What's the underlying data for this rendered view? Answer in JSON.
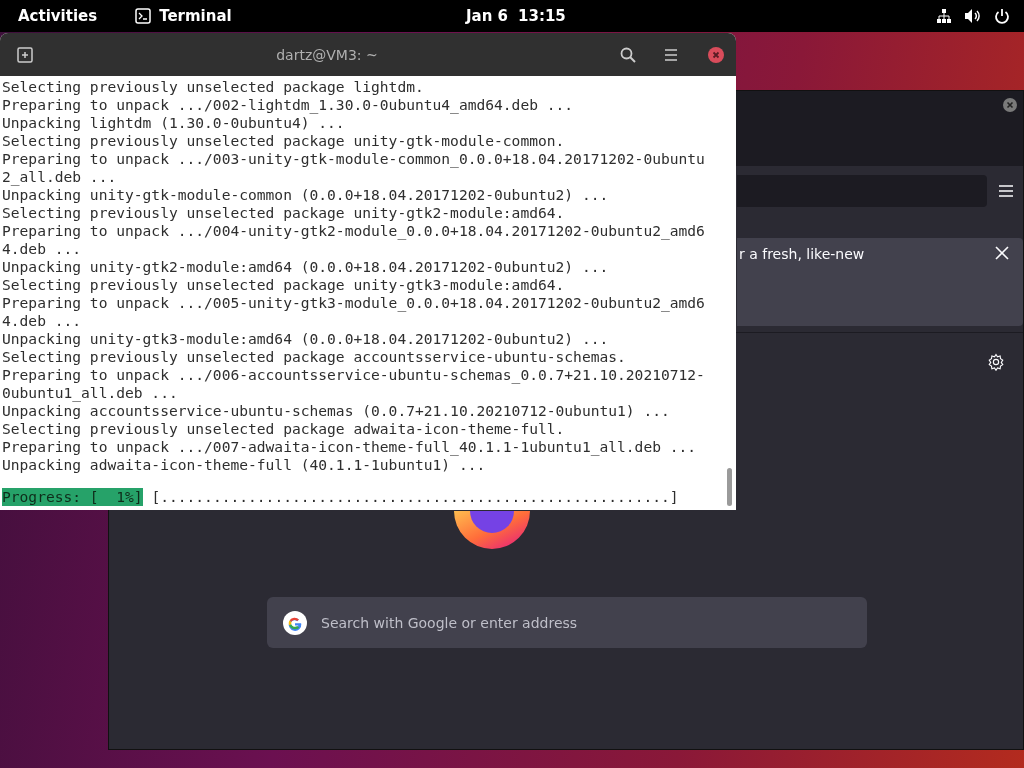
{
  "top_bar": {
    "activities": "Activities",
    "app": "Terminal",
    "date": "Jan 6",
    "time": "13:15"
  },
  "terminal": {
    "title": "dartz@VM3: ~",
    "lines": [
      "Selecting previously unselected package lightdm.",
      "Preparing to unpack .../002-lightdm_1.30.0-0ubuntu4_amd64.deb ...",
      "Unpacking lightdm (1.30.0-0ubuntu4) ...",
      "Selecting previously unselected package unity-gtk-module-common.",
      "Preparing to unpack .../003-unity-gtk-module-common_0.0.0+18.04.20171202-0ubuntu",
      "2_all.deb ...",
      "Unpacking unity-gtk-module-common (0.0.0+18.04.20171202-0ubuntu2) ...",
      "Selecting previously unselected package unity-gtk2-module:amd64.",
      "Preparing to unpack .../004-unity-gtk2-module_0.0.0+18.04.20171202-0ubuntu2_amd6",
      "4.deb ...",
      "Unpacking unity-gtk2-module:amd64 (0.0.0+18.04.20171202-0ubuntu2) ...",
      "Selecting previously unselected package unity-gtk3-module:amd64.",
      "Preparing to unpack .../005-unity-gtk3-module_0.0.0+18.04.20171202-0ubuntu2_amd6",
      "4.deb ...",
      "Unpacking unity-gtk3-module:amd64 (0.0.0+18.04.20171202-0ubuntu2) ...",
      "Selecting previously unselected package accountsservice-ubuntu-schemas.",
      "Preparing to unpack .../006-accountsservice-ubuntu-schemas_0.0.7+21.10.20210712-",
      "0ubuntu1_all.deb ...",
      "Unpacking accountsservice-ubuntu-schemas (0.0.7+21.10.20210712-0ubuntu1) ...",
      "Selecting previously unselected package adwaita-icon-theme-full.",
      "Preparing to unpack .../007-adwaita-icon-theme-full_40.1.1-1ubuntu1_all.deb ...",
      "Unpacking adwaita-icon-theme-full (40.1.1-1ubuntu1) ..."
    ],
    "progress_label": "Progress: [  1%]",
    "progress_bar": "[..........................................................]"
  },
  "browser": {
    "notice": "r a fresh, like-new",
    "search": {
      "placeholder": "Search with Google or enter address"
    }
  }
}
